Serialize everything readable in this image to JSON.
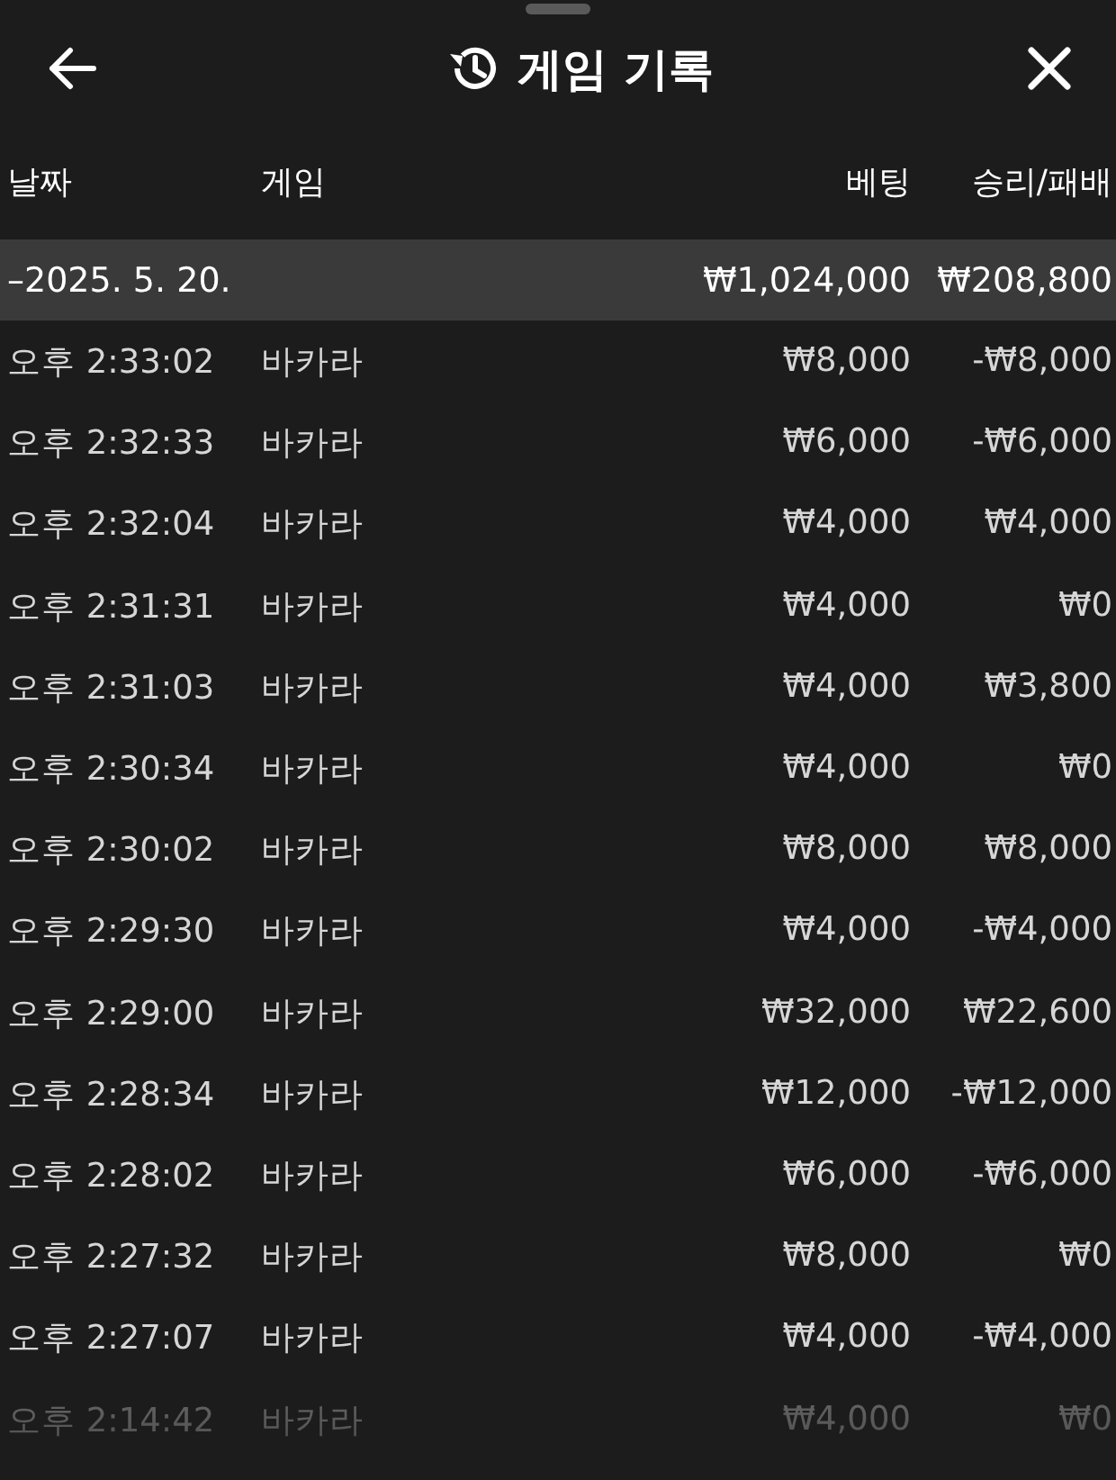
{
  "header": {
    "title": "게임 기록"
  },
  "columns": [
    "날짜",
    "게임",
    "베팅",
    "승리/패배"
  ],
  "groups": [
    {
      "toggle": "–",
      "date": "2025. 5. 20.",
      "bet": "₩1,024,000",
      "result": "₩208,800",
      "rows": [
        {
          "time": "오후 2:33:02",
          "game": "바카라",
          "bet": "₩8,000",
          "result": "-₩8,000"
        },
        {
          "time": "오후 2:32:33",
          "game": "바카라",
          "bet": "₩6,000",
          "result": "-₩6,000"
        },
        {
          "time": "오후 2:32:04",
          "game": "바카라",
          "bet": "₩4,000",
          "result": "₩4,000"
        },
        {
          "time": "오후 2:31:31",
          "game": "바카라",
          "bet": "₩4,000",
          "result": "₩0"
        },
        {
          "time": "오후 2:31:03",
          "game": "바카라",
          "bet": "₩4,000",
          "result": "₩3,800"
        },
        {
          "time": "오후 2:30:34",
          "game": "바카라",
          "bet": "₩4,000",
          "result": "₩0"
        },
        {
          "time": "오후 2:30:02",
          "game": "바카라",
          "bet": "₩8,000",
          "result": "₩8,000"
        },
        {
          "time": "오후 2:29:30",
          "game": "바카라",
          "bet": "₩4,000",
          "result": "-₩4,000"
        },
        {
          "time": "오후 2:29:00",
          "game": "바카라",
          "bet": "₩32,000",
          "result": "₩22,600"
        },
        {
          "time": "오후 2:28:34",
          "game": "바카라",
          "bet": "₩12,000",
          "result": "-₩12,000"
        },
        {
          "time": "오후 2:28:02",
          "game": "바카라",
          "bet": "₩6,000",
          "result": "-₩6,000"
        },
        {
          "time": "오후 2:27:32",
          "game": "바카라",
          "bet": "₩8,000",
          "result": "₩0"
        },
        {
          "time": "오후 2:27:07",
          "game": "바카라",
          "bet": "₩4,000",
          "result": "-₩4,000"
        },
        {
          "time": "오후 2:14:42",
          "game": "바카라",
          "bet": "₩4,000",
          "result": "₩0"
        }
      ]
    }
  ]
}
